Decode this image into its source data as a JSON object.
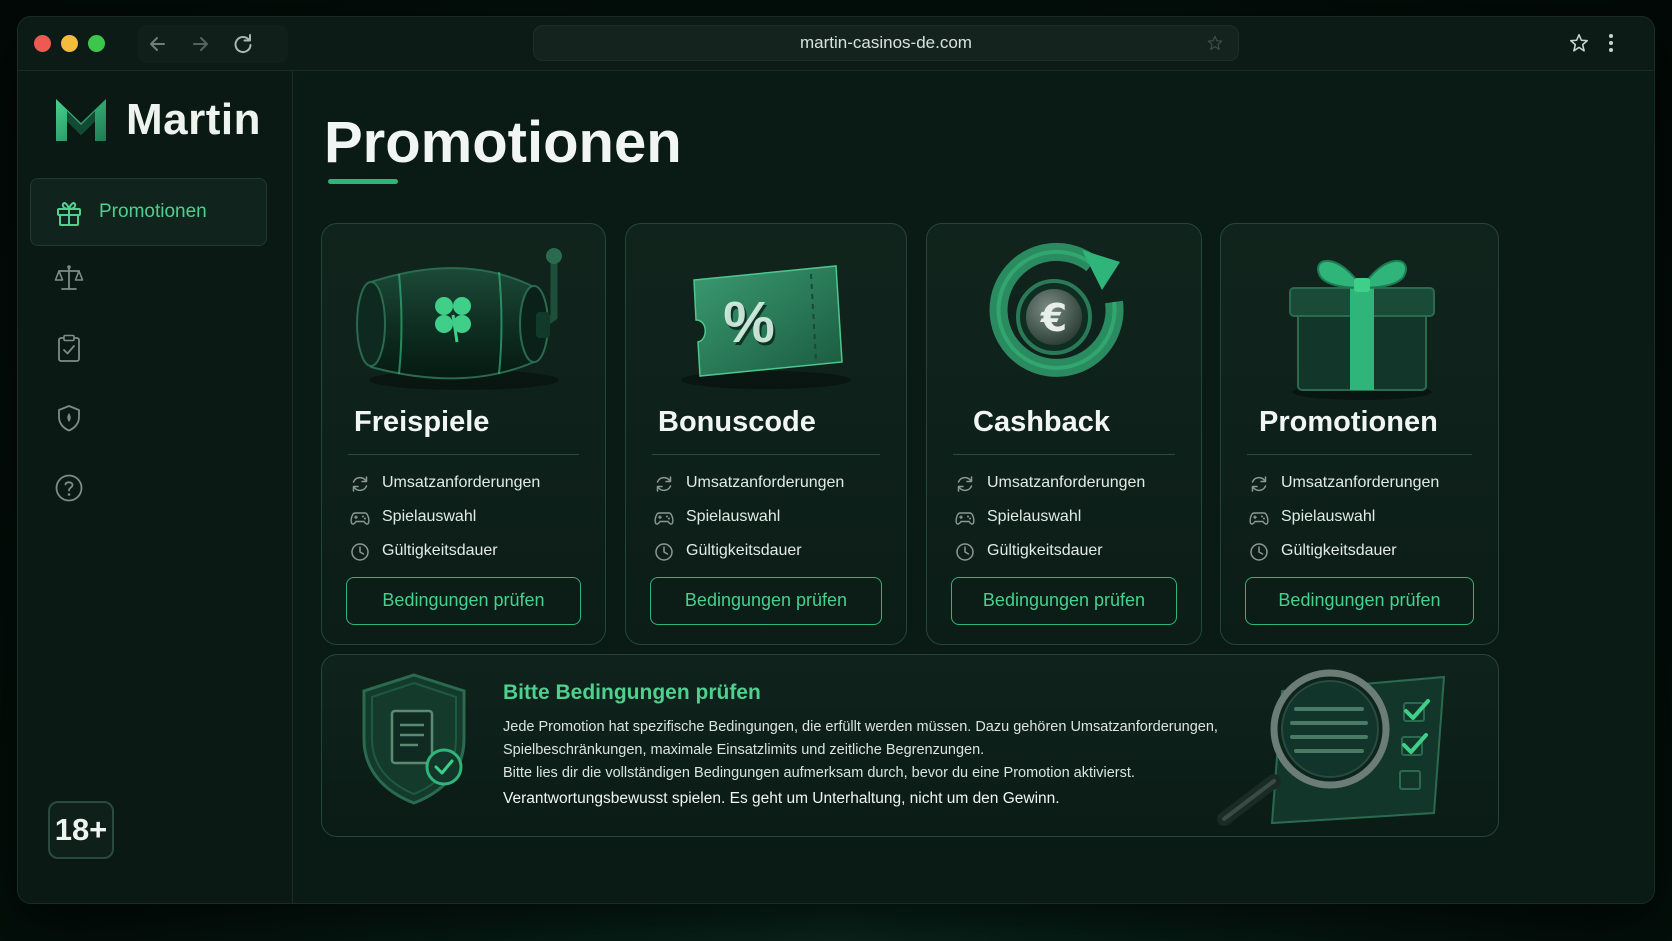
{
  "browser": {
    "url": "martin-casinos-de.com",
    "back_icon": "arrow-left-icon",
    "forward_icon": "arrow-right-icon",
    "reload_icon": "reload-icon",
    "bookmark_icon": "star-icon",
    "menu_icon": "kebab-menu-icon"
  },
  "brand": {
    "name": "Martin",
    "accent": "#2fb47a",
    "accent_text": "#4fd08e"
  },
  "sidebar": {
    "items": [
      {
        "label": "Promotionen",
        "icon": "gift-icon",
        "active": true
      },
      {
        "label": "",
        "icon": "scales-icon",
        "active": false
      },
      {
        "label": "",
        "icon": "clipboard-check-icon",
        "active": false
      },
      {
        "label": "",
        "icon": "shield-icon",
        "active": false
      },
      {
        "label": "",
        "icon": "help-icon",
        "active": false
      }
    ],
    "age_badge": "18+"
  },
  "main": {
    "title": "Promotionen",
    "cards": [
      {
        "title": "Freispiele",
        "art": "slot-reel-clover",
        "rows": [
          {
            "icon": "refresh-icon",
            "label": "Umsatzanforderungen"
          },
          {
            "icon": "gamepad-icon",
            "label": "Spielauswahl"
          },
          {
            "icon": "clock-icon",
            "label": "Gültigkeitsdauer"
          }
        ],
        "button": "Bedingungen prüfen"
      },
      {
        "title": "Bonuscode",
        "art": "percent-ticket",
        "rows": [
          {
            "icon": "refresh-icon",
            "label": "Umsatzanforderungen"
          },
          {
            "icon": "gamepad-icon",
            "label": "Spielauswahl"
          },
          {
            "icon": "clock-icon",
            "label": "Gültigkeitsdauer"
          }
        ],
        "button": "Bedingungen prüfen"
      },
      {
        "title": "Cashback",
        "art": "euro-coin-refresh",
        "rows": [
          {
            "icon": "refresh-icon",
            "label": "Umsatzanforderungen"
          },
          {
            "icon": "gamepad-icon",
            "label": "Spielauswahl"
          },
          {
            "icon": "clock-icon",
            "label": "Gültigkeitsdauer"
          }
        ],
        "button": "Bedingungen prüfen"
      },
      {
        "title": "Promotionen",
        "art": "gift-box",
        "rows": [
          {
            "icon": "refresh-icon",
            "label": "Umsatzanforderungen"
          },
          {
            "icon": "gamepad-icon",
            "label": "Spielauswahl"
          },
          {
            "icon": "clock-icon",
            "label": "Gültigkeitsdauer"
          }
        ],
        "button": "Bedingungen prüfen"
      }
    ],
    "info": {
      "title": "Bitte Bedingungen prüfen",
      "line1": "Jede Promotion hat spezifische Bedingungen, die erfüllt werden müssen. Dazu gehören Umsatzanforderungen,",
      "line2": "Spielbeschränkungen, maximale Einsatzlimits und zeitliche Begrenzungen.",
      "line3": "Bitte lies dir die vollständigen Bedingungen aufmerksam durch, bevor du eine Promotion aktivierst.",
      "line4": "Verantwortungsbewusst spielen. Es geht um Unterhaltung, nicht um den Gewinn.",
      "left_art": "shield-document-check",
      "right_art": "magnifier-checklist"
    }
  }
}
